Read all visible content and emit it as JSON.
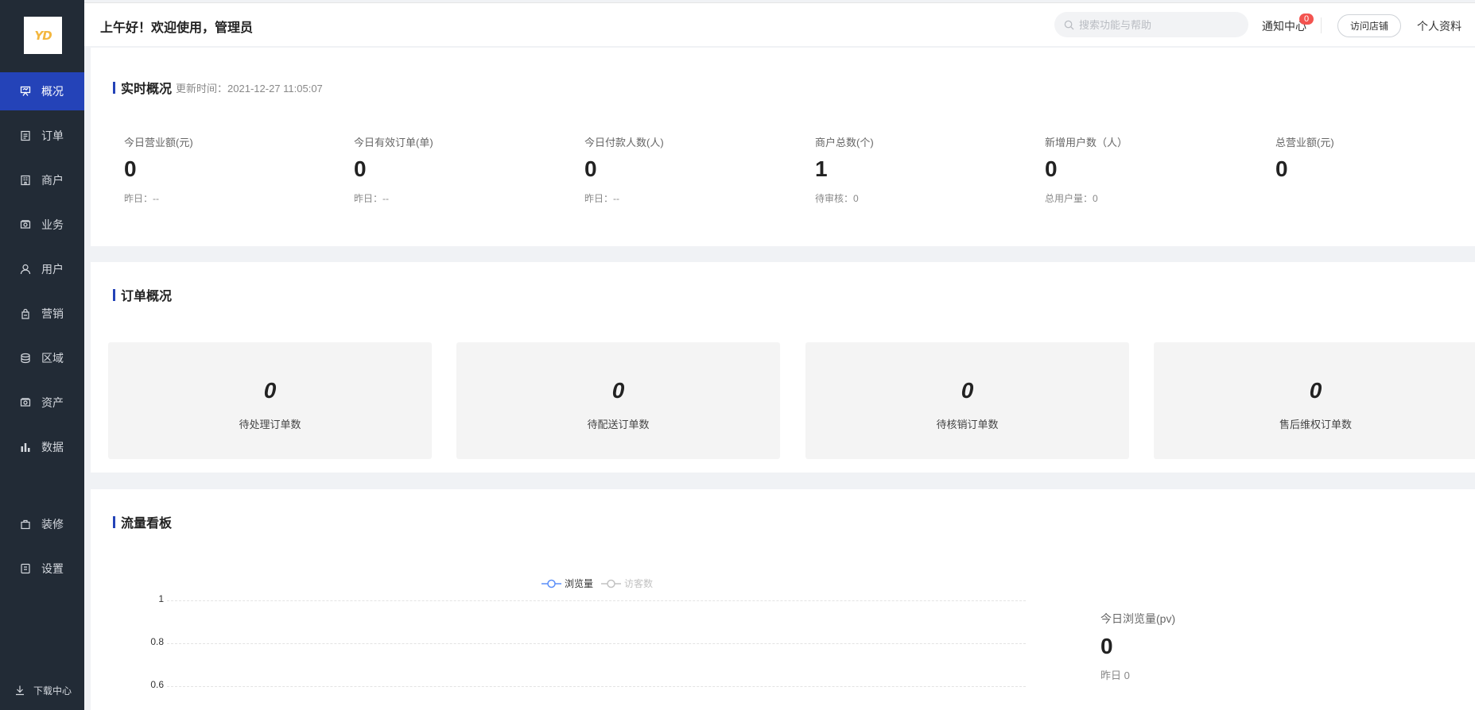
{
  "logo": {
    "text": "YD"
  },
  "sidebar": {
    "items": [
      {
        "label": "概况",
        "icon": "dashboard-icon",
        "active": true
      },
      {
        "label": "订单",
        "icon": "order-icon"
      },
      {
        "label": "商户",
        "icon": "merchant-icon"
      },
      {
        "label": "业务",
        "icon": "business-icon"
      },
      {
        "label": "用户",
        "icon": "user-icon"
      },
      {
        "label": "营销",
        "icon": "marketing-icon"
      },
      {
        "label": "区域",
        "icon": "region-icon"
      },
      {
        "label": "资产",
        "icon": "asset-icon"
      },
      {
        "label": "数据",
        "icon": "data-chart-icon"
      },
      {
        "label": "装修",
        "icon": "decoration-icon"
      },
      {
        "label": "设置",
        "icon": "settings-icon"
      }
    ],
    "bottom": {
      "download_label": "下载中心"
    }
  },
  "header": {
    "greeting": "上午好！欢迎使用，管理员",
    "search_placeholder": "搜索功能与帮助",
    "notify_label": "通知中心",
    "notify_count": "0",
    "visit_store_label": "访问店铺",
    "profile_label": "个人资料"
  },
  "realtime": {
    "title": "实时概况",
    "update_prefix": "更新时间：",
    "update_time": "2021-12-27 11:05:07",
    "stats": [
      {
        "label": "今日营业额(元)",
        "value": "0",
        "foot": "昨日：--"
      },
      {
        "label": "今日有效订单(单)",
        "value": "0",
        "foot": "昨日：--"
      },
      {
        "label": "今日付款人数(人)",
        "value": "0",
        "foot": "昨日：--"
      },
      {
        "label": "商户总数(个)",
        "value": "1",
        "foot": "待审核：0"
      },
      {
        "label": "新增用户数（人）",
        "value": "0",
        "foot": "总用户量：0"
      },
      {
        "label": "总营业额(元)",
        "value": "0",
        "foot": ""
      }
    ]
  },
  "orders": {
    "title": "订单概况",
    "cards": [
      {
        "value": "0",
        "label": "待处理订单数"
      },
      {
        "value": "0",
        "label": "待配送订单数"
      },
      {
        "value": "0",
        "label": "待核销订单数"
      },
      {
        "value": "0",
        "label": "售后维权订单数"
      }
    ]
  },
  "traffic": {
    "title": "流量看板",
    "side": {
      "label": "今日浏览量(pv)",
      "value": "0",
      "foot": "昨日 0"
    }
  },
  "chart_data": {
    "type": "line",
    "series": [
      {
        "name": "浏览量",
        "values": [],
        "color": "#5b8ff9",
        "visible": true
      },
      {
        "name": "访客数",
        "values": [],
        "color": "#c2c2c2",
        "visible": false
      }
    ],
    "yticks": [
      "1",
      "0.8",
      "0.6"
    ],
    "ylim": [
      0,
      1
    ],
    "legend": "top-center",
    "grid": true
  }
}
